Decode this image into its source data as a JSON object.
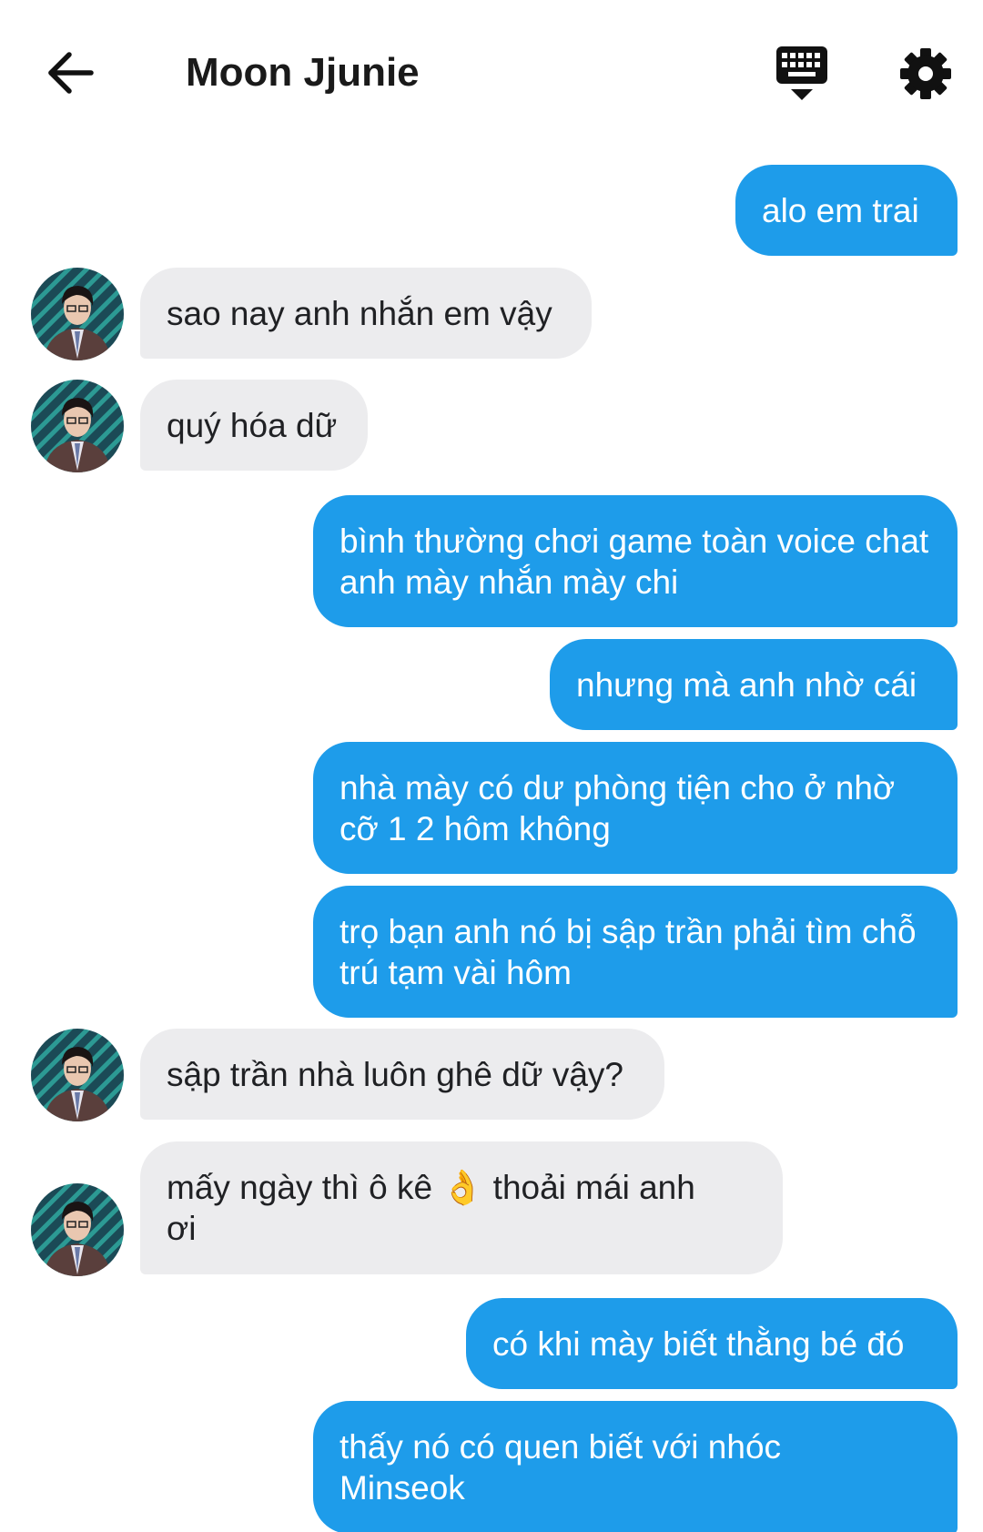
{
  "header": {
    "title": "Moon Jjunie",
    "back_icon": "arrow-left-icon",
    "keyboard_icon": "keyboard-hide-icon",
    "settings_icon": "gear-icon"
  },
  "colors": {
    "outgoing_bubble": "#1e9cea",
    "incoming_bubble": "#ececee",
    "outgoing_text": "#ffffff",
    "incoming_text": "#202124",
    "avatar_ring": "#1f7a7a"
  },
  "messages": [
    {
      "sender": "me",
      "text": "alo em trai"
    },
    {
      "sender": "contact",
      "text": "sao nay anh nhắn em vậy"
    },
    {
      "sender": "contact",
      "text": "quý hóa dữ"
    },
    {
      "sender": "me",
      "text": "bình thường chơi game toàn voice chat anh mày nhắn mày chi"
    },
    {
      "sender": "me",
      "text": "nhưng mà anh nhờ cái"
    },
    {
      "sender": "me",
      "text": "nhà mày có dư phòng tiện cho ở nhờ cỡ 1 2 hôm không"
    },
    {
      "sender": "me",
      "text": "trọ bạn anh nó bị sập trần phải tìm chỗ trú tạm vài hôm"
    },
    {
      "sender": "contact",
      "text": "sập trần nhà luôn ghê dữ vậy?"
    },
    {
      "sender": "contact",
      "text": "mấy ngày thì ô kê 👌 thoải mái anh ơi"
    },
    {
      "sender": "me",
      "text": "có khi mày biết thằng bé đó"
    },
    {
      "sender": "me",
      "text": "thấy nó có quen biết với nhóc Minseok"
    }
  ]
}
